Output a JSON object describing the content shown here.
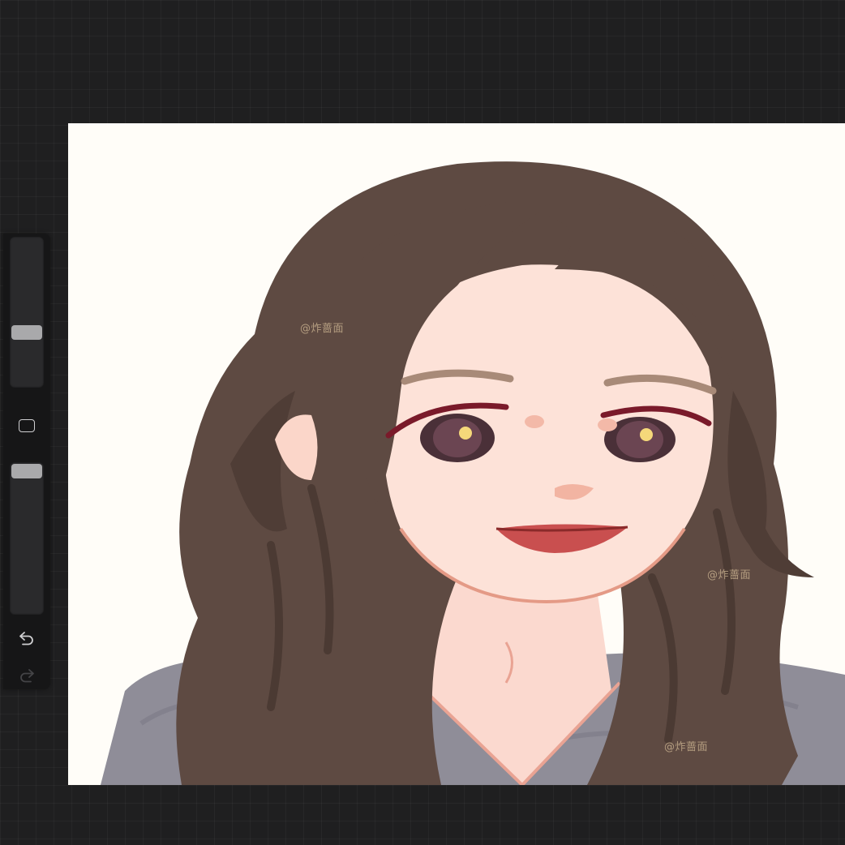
{
  "toolbar": {
    "icons": {
      "modify": "square-icon",
      "undo": "undo-arrow-icon",
      "redo": "redo-arrow-icon"
    },
    "brush_size_level": 0.35,
    "brush_opacity_level": 1.0
  },
  "canvas": {
    "watermarks": [
      "@炸蔷面",
      "@炸蔷面",
      "@炸蔷面"
    ]
  },
  "colors": {
    "app_background": "#1f1f20",
    "sidebar": "#161617",
    "slider_thumb": "#a9a9ab",
    "canvas_paper": "#fffdf8",
    "hair": "#5e4a42",
    "skin": "#fde2d8",
    "sweater": "#8f8d98"
  }
}
